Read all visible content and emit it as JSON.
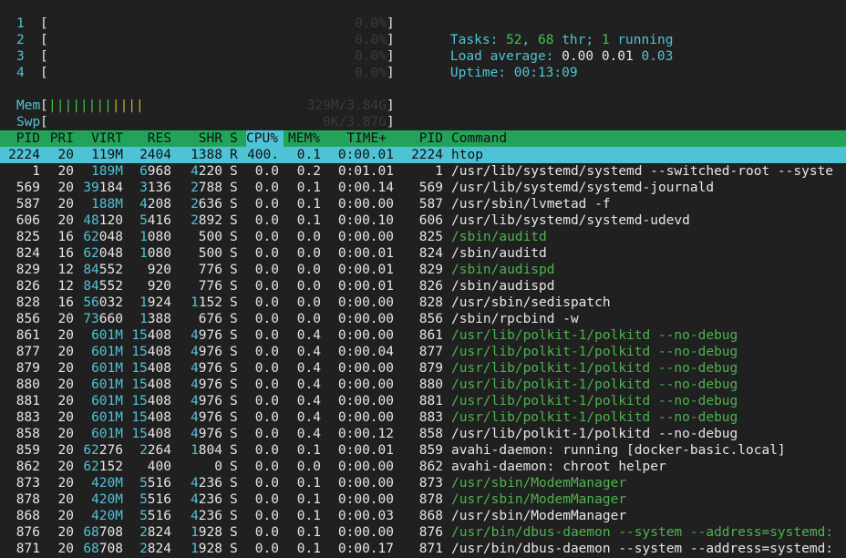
{
  "cpu_meters": [
    {
      "label": "1",
      "value": "0.0%"
    },
    {
      "label": "2",
      "value": "0.0%"
    },
    {
      "label": "3",
      "value": "0.0%"
    },
    {
      "label": "4",
      "value": "0.0%"
    }
  ],
  "mem_meter": {
    "label": "Mem",
    "bars": "||||||||||||",
    "value": "329M/3.84G"
  },
  "swp_meter": {
    "label": "Swp",
    "value": "0K/3.87G"
  },
  "summary": {
    "tasks_label": "Tasks:",
    "tasks_count": "52",
    "threads_count": "68",
    "thr_label": "thr;",
    "running_count": "1",
    "running_label": "running",
    "load_label": "Load average:",
    "load_1": "0.00",
    "load_5": "0.01",
    "load_15": "0.03",
    "uptime_label": "Uptime:",
    "uptime_value": "00:13:09"
  },
  "columns": {
    "pid": "PID",
    "pri": "PRI",
    "virt": "VIRT",
    "res": "RES",
    "shr": "SHR",
    "s": "S",
    "cpu": "CPU%",
    "mem": "MEM%",
    "time": "TIME+",
    "pid2": "PID",
    "command": "Command"
  },
  "processes": [
    {
      "pid": "2224",
      "pri": "20",
      "virt": "119M",
      "res": "2404",
      "shr": "1388",
      "s": "R",
      "cpu": "400.",
      "mem": "0.1",
      "time": "0:00.01",
      "pid2": "2224",
      "command": "htop",
      "thread": false
    },
    {
      "pid": "1",
      "pri": "20",
      "virt": "189M",
      "res": "6968",
      "shr": "4220",
      "s": "S",
      "cpu": "0.0",
      "mem": "0.2",
      "time": "0:01.01",
      "pid2": "1",
      "command": "/usr/lib/systemd/systemd --switched-root --syste",
      "thread": false
    },
    {
      "pid": "569",
      "pri": "20",
      "virt": "39184",
      "res": "3136",
      "shr": "2788",
      "s": "S",
      "cpu": "0.0",
      "mem": "0.1",
      "time": "0:00.14",
      "pid2": "569",
      "command": "/usr/lib/systemd/systemd-journald",
      "thread": false
    },
    {
      "pid": "587",
      "pri": "20",
      "virt": "188M",
      "res": "4208",
      "shr": "2636",
      "s": "S",
      "cpu": "0.0",
      "mem": "0.1",
      "time": "0:00.00",
      "pid2": "587",
      "command": "/usr/sbin/lvmetad -f",
      "thread": false
    },
    {
      "pid": "606",
      "pri": "20",
      "virt": "48120",
      "res": "5416",
      "shr": "2892",
      "s": "S",
      "cpu": "0.0",
      "mem": "0.1",
      "time": "0:00.10",
      "pid2": "606",
      "command": "/usr/lib/systemd/systemd-udevd",
      "thread": false
    },
    {
      "pid": "825",
      "pri": "16",
      "virt": "62048",
      "res": "1080",
      "shr": "500",
      "s": "S",
      "cpu": "0.0",
      "mem": "0.0",
      "time": "0:00.00",
      "pid2": "825",
      "command": "/sbin/auditd",
      "thread": true
    },
    {
      "pid": "824",
      "pri": "16",
      "virt": "62048",
      "res": "1080",
      "shr": "500",
      "s": "S",
      "cpu": "0.0",
      "mem": "0.0",
      "time": "0:00.01",
      "pid2": "824",
      "command": "/sbin/auditd",
      "thread": false
    },
    {
      "pid": "829",
      "pri": "12",
      "virt": "84552",
      "res": "920",
      "shr": "776",
      "s": "S",
      "cpu": "0.0",
      "mem": "0.0",
      "time": "0:00.01",
      "pid2": "829",
      "command": "/sbin/audispd",
      "thread": true
    },
    {
      "pid": "826",
      "pri": "12",
      "virt": "84552",
      "res": "920",
      "shr": "776",
      "s": "S",
      "cpu": "0.0",
      "mem": "0.0",
      "time": "0:00.01",
      "pid2": "826",
      "command": "/sbin/audispd",
      "thread": false
    },
    {
      "pid": "828",
      "pri": "16",
      "virt": "56032",
      "res": "1924",
      "shr": "1152",
      "s": "S",
      "cpu": "0.0",
      "mem": "0.0",
      "time": "0:00.00",
      "pid2": "828",
      "command": "/usr/sbin/sedispatch",
      "thread": false
    },
    {
      "pid": "856",
      "pri": "20",
      "virt": "73660",
      "res": "1388",
      "shr": "676",
      "s": "S",
      "cpu": "0.0",
      "mem": "0.0",
      "time": "0:00.00",
      "pid2": "856",
      "command": "/sbin/rpcbind -w",
      "thread": false
    },
    {
      "pid": "861",
      "pri": "20",
      "virt": "601M",
      "res": "15408",
      "shr": "4976",
      "s": "S",
      "cpu": "0.0",
      "mem": "0.4",
      "time": "0:00.00",
      "pid2": "861",
      "command": "/usr/lib/polkit-1/polkitd --no-debug",
      "thread": true
    },
    {
      "pid": "877",
      "pri": "20",
      "virt": "601M",
      "res": "15408",
      "shr": "4976",
      "s": "S",
      "cpu": "0.0",
      "mem": "0.4",
      "time": "0:00.04",
      "pid2": "877",
      "command": "/usr/lib/polkit-1/polkitd --no-debug",
      "thread": true
    },
    {
      "pid": "879",
      "pri": "20",
      "virt": "601M",
      "res": "15408",
      "shr": "4976",
      "s": "S",
      "cpu": "0.0",
      "mem": "0.4",
      "time": "0:00.00",
      "pid2": "879",
      "command": "/usr/lib/polkit-1/polkitd --no-debug",
      "thread": true
    },
    {
      "pid": "880",
      "pri": "20",
      "virt": "601M",
      "res": "15408",
      "shr": "4976",
      "s": "S",
      "cpu": "0.0",
      "mem": "0.4",
      "time": "0:00.00",
      "pid2": "880",
      "command": "/usr/lib/polkit-1/polkitd --no-debug",
      "thread": true
    },
    {
      "pid": "881",
      "pri": "20",
      "virt": "601M",
      "res": "15408",
      "shr": "4976",
      "s": "S",
      "cpu": "0.0",
      "mem": "0.4",
      "time": "0:00.00",
      "pid2": "881",
      "command": "/usr/lib/polkit-1/polkitd --no-debug",
      "thread": true
    },
    {
      "pid": "883",
      "pri": "20",
      "virt": "601M",
      "res": "15408",
      "shr": "4976",
      "s": "S",
      "cpu": "0.0",
      "mem": "0.4",
      "time": "0:00.00",
      "pid2": "883",
      "command": "/usr/lib/polkit-1/polkitd --no-debug",
      "thread": true
    },
    {
      "pid": "858",
      "pri": "20",
      "virt": "601M",
      "res": "15408",
      "shr": "4976",
      "s": "S",
      "cpu": "0.0",
      "mem": "0.4",
      "time": "0:00.12",
      "pid2": "858",
      "command": "/usr/lib/polkit-1/polkitd --no-debug",
      "thread": false
    },
    {
      "pid": "859",
      "pri": "20",
      "virt": "62276",
      "res": "2264",
      "shr": "1804",
      "s": "S",
      "cpu": "0.0",
      "mem": "0.1",
      "time": "0:00.01",
      "pid2": "859",
      "command": "avahi-daemon: running [docker-basic.local]",
      "thread": false
    },
    {
      "pid": "862",
      "pri": "20",
      "virt": "62152",
      "res": "400",
      "shr": "0",
      "s": "S",
      "cpu": "0.0",
      "mem": "0.0",
      "time": "0:00.00",
      "pid2": "862",
      "command": "avahi-daemon: chroot helper",
      "thread": false
    },
    {
      "pid": "873",
      "pri": "20",
      "virt": "420M",
      "res": "5516",
      "shr": "4236",
      "s": "S",
      "cpu": "0.0",
      "mem": "0.1",
      "time": "0:00.00",
      "pid2": "873",
      "command": "/usr/sbin/ModemManager",
      "thread": true
    },
    {
      "pid": "878",
      "pri": "20",
      "virt": "420M",
      "res": "5516",
      "shr": "4236",
      "s": "S",
      "cpu": "0.0",
      "mem": "0.1",
      "time": "0:00.00",
      "pid2": "878",
      "command": "/usr/sbin/ModemManager",
      "thread": true
    },
    {
      "pid": "868",
      "pri": "20",
      "virt": "420M",
      "res": "5516",
      "shr": "4236",
      "s": "S",
      "cpu": "0.0",
      "mem": "0.1",
      "time": "0:00.03",
      "pid2": "868",
      "command": "/usr/sbin/ModemManager",
      "thread": false
    },
    {
      "pid": "876",
      "pri": "20",
      "virt": "68708",
      "res": "2824",
      "shr": "1928",
      "s": "S",
      "cpu": "0.0",
      "mem": "0.1",
      "time": "0:00.00",
      "pid2": "876",
      "command": "/usr/bin/dbus-daemon --system --address=systemd:",
      "thread": true
    },
    {
      "pid": "871",
      "pri": "20",
      "virt": "68708",
      "res": "2824",
      "shr": "1928",
      "s": "S",
      "cpu": "0.0",
      "mem": "0.1",
      "time": "0:00.17",
      "pid2": "871",
      "command": "/usr/bin/dbus-daemon --system --address=systemd:",
      "thread": false
    }
  ],
  "colors": {
    "background": "#202020",
    "header_bar": "#23a35a",
    "selected_row": "#4fc3d6",
    "cyan": "#4fc3d6",
    "thread_green": "#4db34d",
    "mem_bar_yellow": "#c9b32b"
  }
}
